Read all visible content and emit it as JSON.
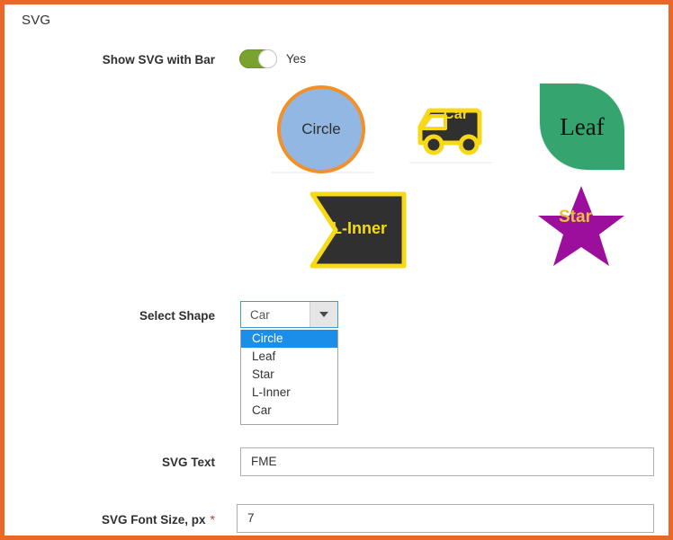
{
  "section": {
    "title": "SVG"
  },
  "theme": {
    "frame_border": "#e8682a",
    "toggle_on": "#79a22e",
    "select_focus_border": "#3d9bdd",
    "option_highlight": "#1b8eea",
    "required_marker": "#e02b27"
  },
  "fields": {
    "show_svg_with_bar": {
      "label": "Show SVG with Bar",
      "value": "Yes",
      "state": "on"
    },
    "select_shape": {
      "label": "Select Shape",
      "value": "Car",
      "dropdown_open": true,
      "options": [
        {
          "label": "Circle",
          "highlighted": true
        },
        {
          "label": "Leaf",
          "highlighted": false
        },
        {
          "label": "Star",
          "highlighted": false
        },
        {
          "label": "L-Inner",
          "highlighted": false
        },
        {
          "label": "Car",
          "highlighted": false
        }
      ]
    },
    "svg_text": {
      "label": "SVG Text",
      "value": "FME",
      "required": false
    },
    "svg_font_size": {
      "label": "SVG Font Size, px",
      "value": "7",
      "required": true,
      "required_marker": "*"
    }
  },
  "shape_previews": [
    {
      "name": "circle",
      "text": "Circle",
      "fill": "#93b7e3",
      "stroke": "#f2902a",
      "text_color": "#2f2f2f"
    },
    {
      "name": "car",
      "text": "Car",
      "fill": "#303030",
      "stroke": "#f7d917",
      "text_color": "#f7d917"
    },
    {
      "name": "leaf",
      "text": "Leaf",
      "fill": "#35a46e",
      "stroke": "#35a46e",
      "text_color": "#101010"
    },
    {
      "name": "l-inner",
      "text": "L-Inner",
      "fill": "#303030",
      "stroke": "#f7d917",
      "text_color": "#f7d917"
    },
    {
      "name": "star",
      "text": "Star",
      "fill": "#9c0f9c",
      "stroke": "#9c0f9c",
      "text_color": "#e8c33a"
    }
  ]
}
